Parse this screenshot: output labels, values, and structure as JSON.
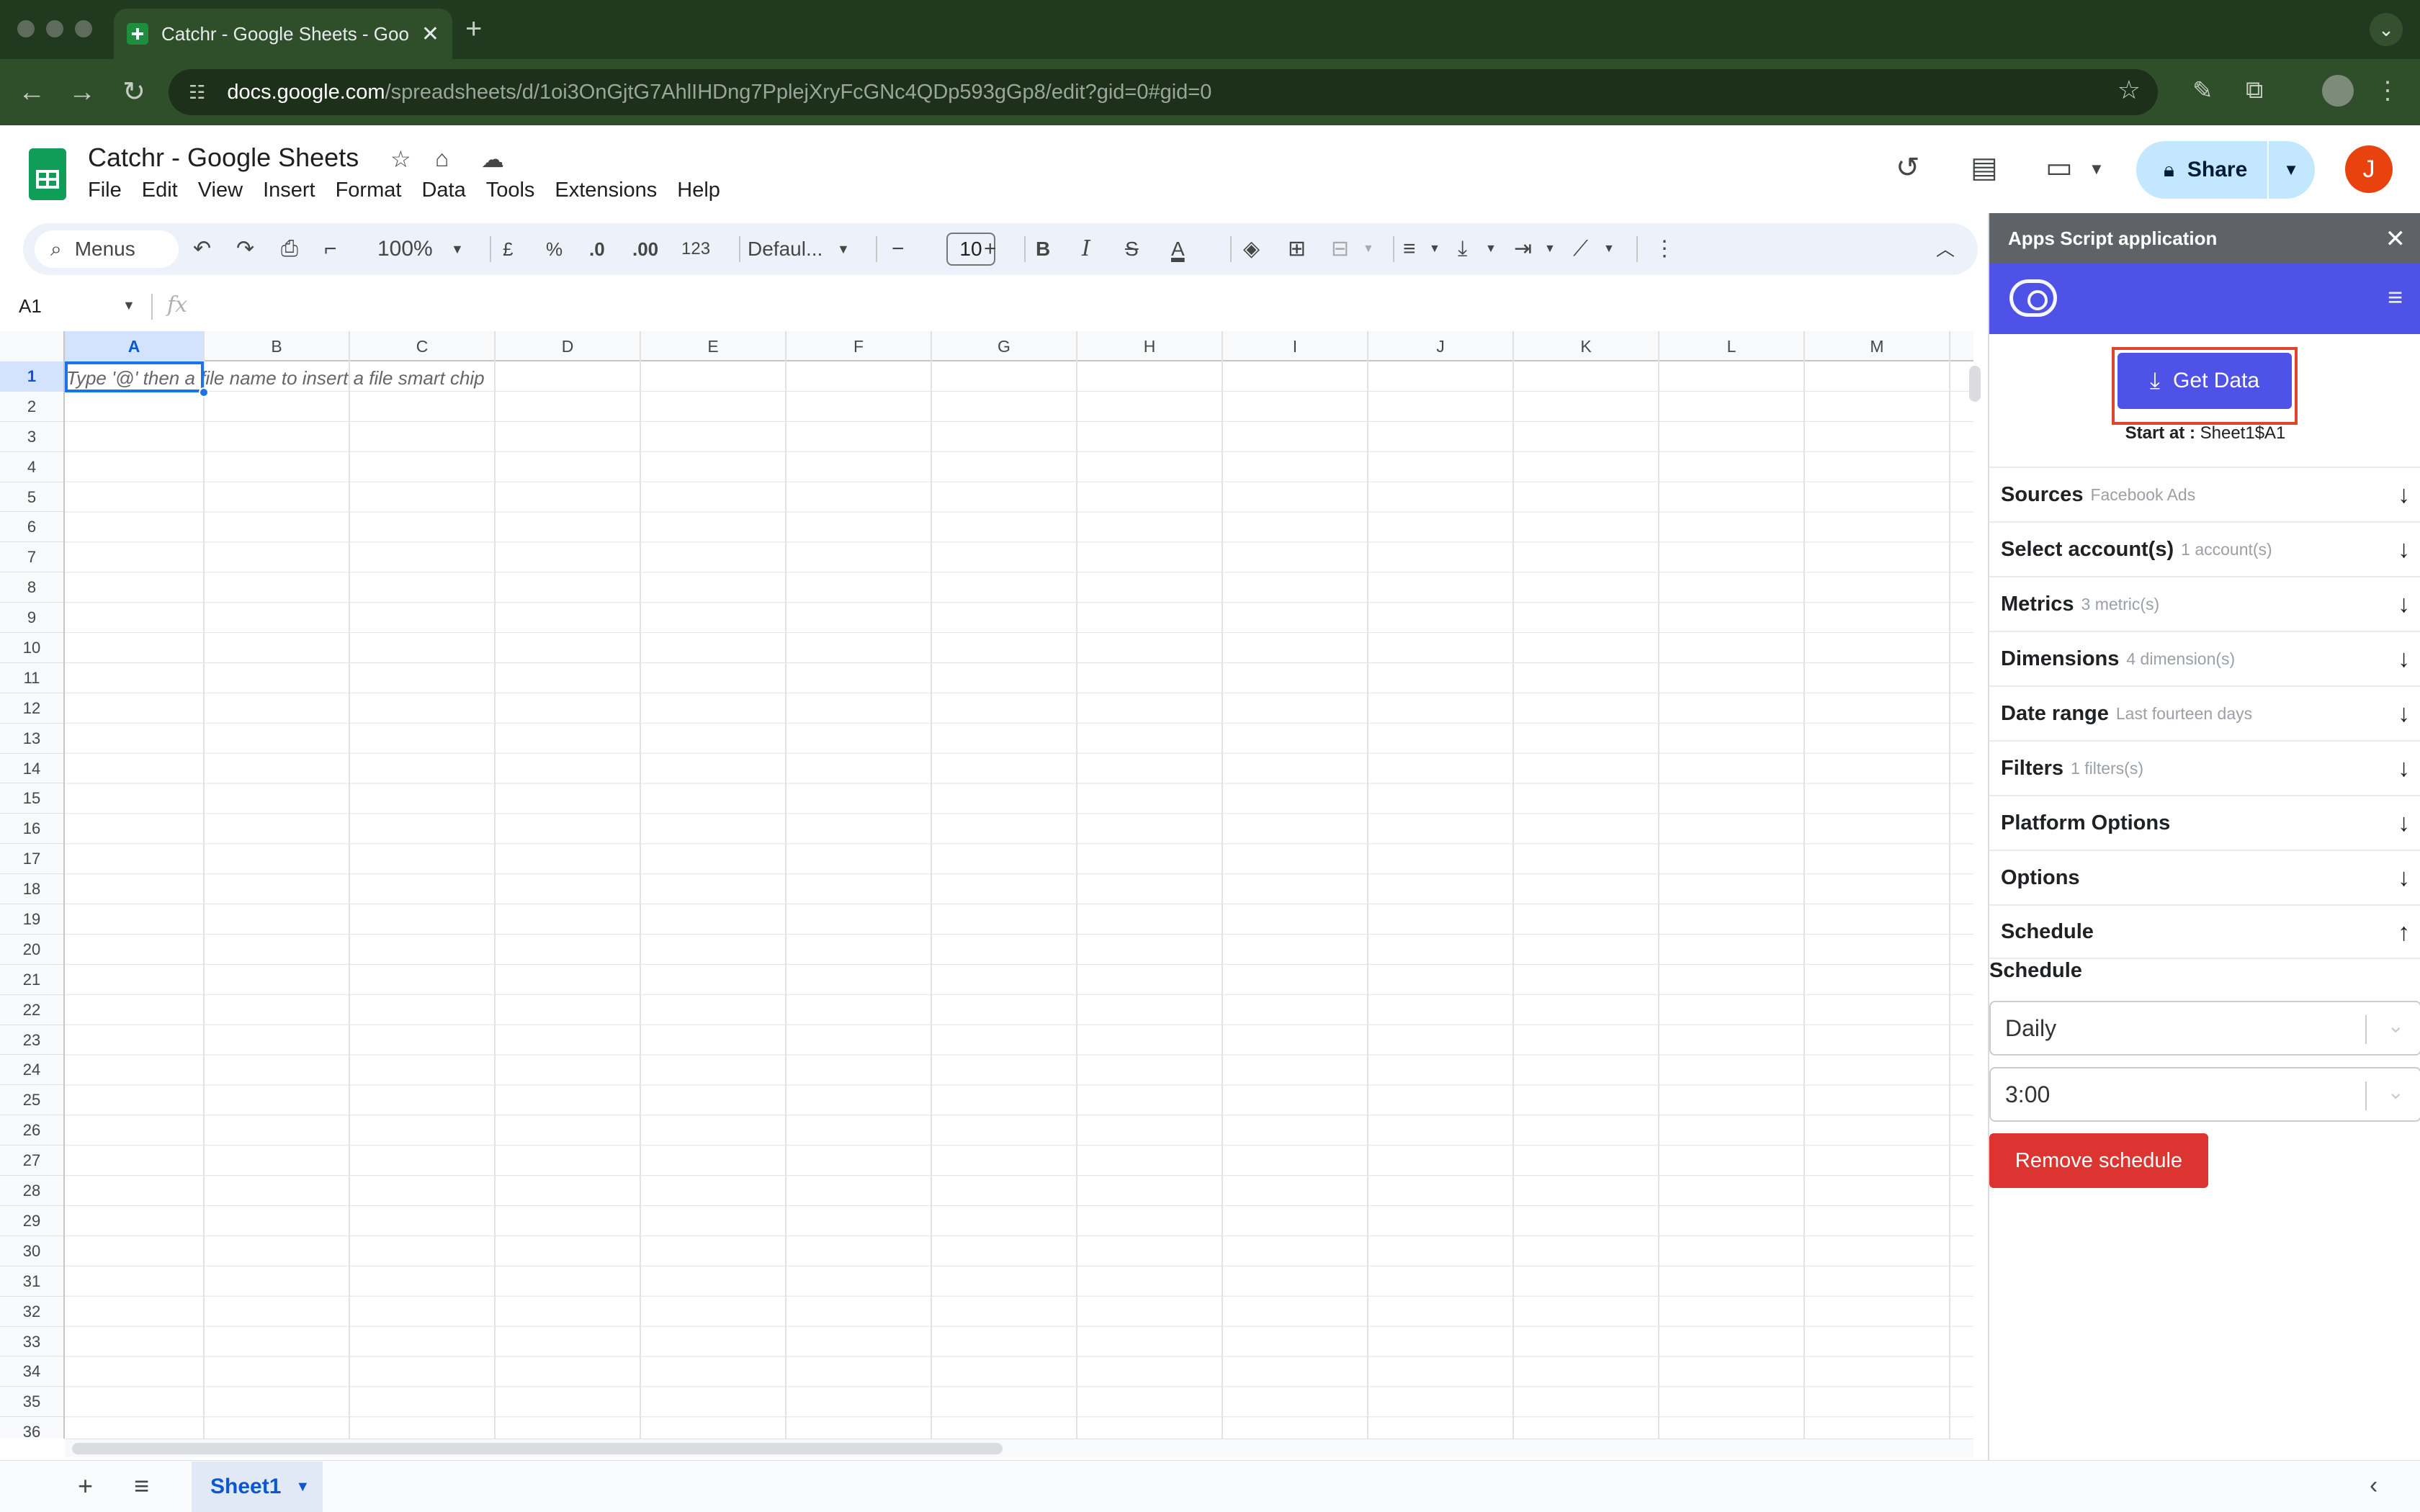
{
  "browser": {
    "tab_title": "Catchr - Google Sheets - Goo",
    "tab_close": "✕",
    "new_tab": "+",
    "url_host": "docs.google.com",
    "url_path": "/spreadsheets/d/1oi3OnGjtG7AhlIHDng7PplejXryFcGNc4QDp593gGp8/edit?gid=0#gid=0"
  },
  "sheets": {
    "title": "Catchr - Google Sheets",
    "menu": [
      "File",
      "Edit",
      "View",
      "Insert",
      "Format",
      "Data",
      "Tools",
      "Extensions",
      "Help"
    ],
    "share_label": "Share",
    "avatar_initial": "J",
    "toolbar": {
      "menus_label": "Menus",
      "zoom": "100%",
      "currency": "£",
      "percent": "%",
      "dec_decrease": ".0",
      "dec_increase": ".00",
      "number_format": "123",
      "font": "Defaul...",
      "font_size": "10",
      "bold": "B",
      "italic": "I",
      "strike": "S",
      "text_color": "A"
    },
    "name_box": "A1",
    "fx": "fx",
    "columns": [
      "A",
      "B",
      "C",
      "D",
      "E",
      "F",
      "G",
      "H",
      "I",
      "J",
      "K",
      "L",
      "M"
    ],
    "rows": [
      "1",
      "2",
      "3",
      "4",
      "5",
      "6",
      "7",
      "8",
      "9",
      "10",
      "11",
      "12",
      "13",
      "14",
      "15",
      "16",
      "17",
      "18",
      "19",
      "20",
      "21",
      "22",
      "23",
      "24",
      "25",
      "26",
      "27",
      "28",
      "29",
      "30",
      "31",
      "32",
      "33",
      "34",
      "35",
      "36"
    ],
    "cell_hint": "Type '@' then a file name to insert a file smart chip",
    "sheet_tab": "Sheet1"
  },
  "panel": {
    "header_title": "Apps Script application",
    "get_data_label": "Get Data",
    "start_at_label": "Start at :",
    "start_at_value": "Sheet1$A1",
    "sections": [
      {
        "title": "Sources",
        "sub": "Facebook Ads"
      },
      {
        "title": "Select account(s)",
        "sub": "1 account(s)"
      },
      {
        "title": "Metrics",
        "sub": "3 metric(s)"
      },
      {
        "title": "Dimensions",
        "sub": "4 dimension(s)"
      },
      {
        "title": "Date range",
        "sub": "Last fourteen days"
      },
      {
        "title": "Filters",
        "sub": "1 filters(s)"
      },
      {
        "title": "Platform Options",
        "sub": ""
      },
      {
        "title": "Options",
        "sub": ""
      },
      {
        "title": "Schedule",
        "sub": ""
      }
    ],
    "schedule_label": "Schedule",
    "frequency_value": "Daily",
    "time_value": "3:00",
    "remove_label": "Remove schedule"
  }
}
